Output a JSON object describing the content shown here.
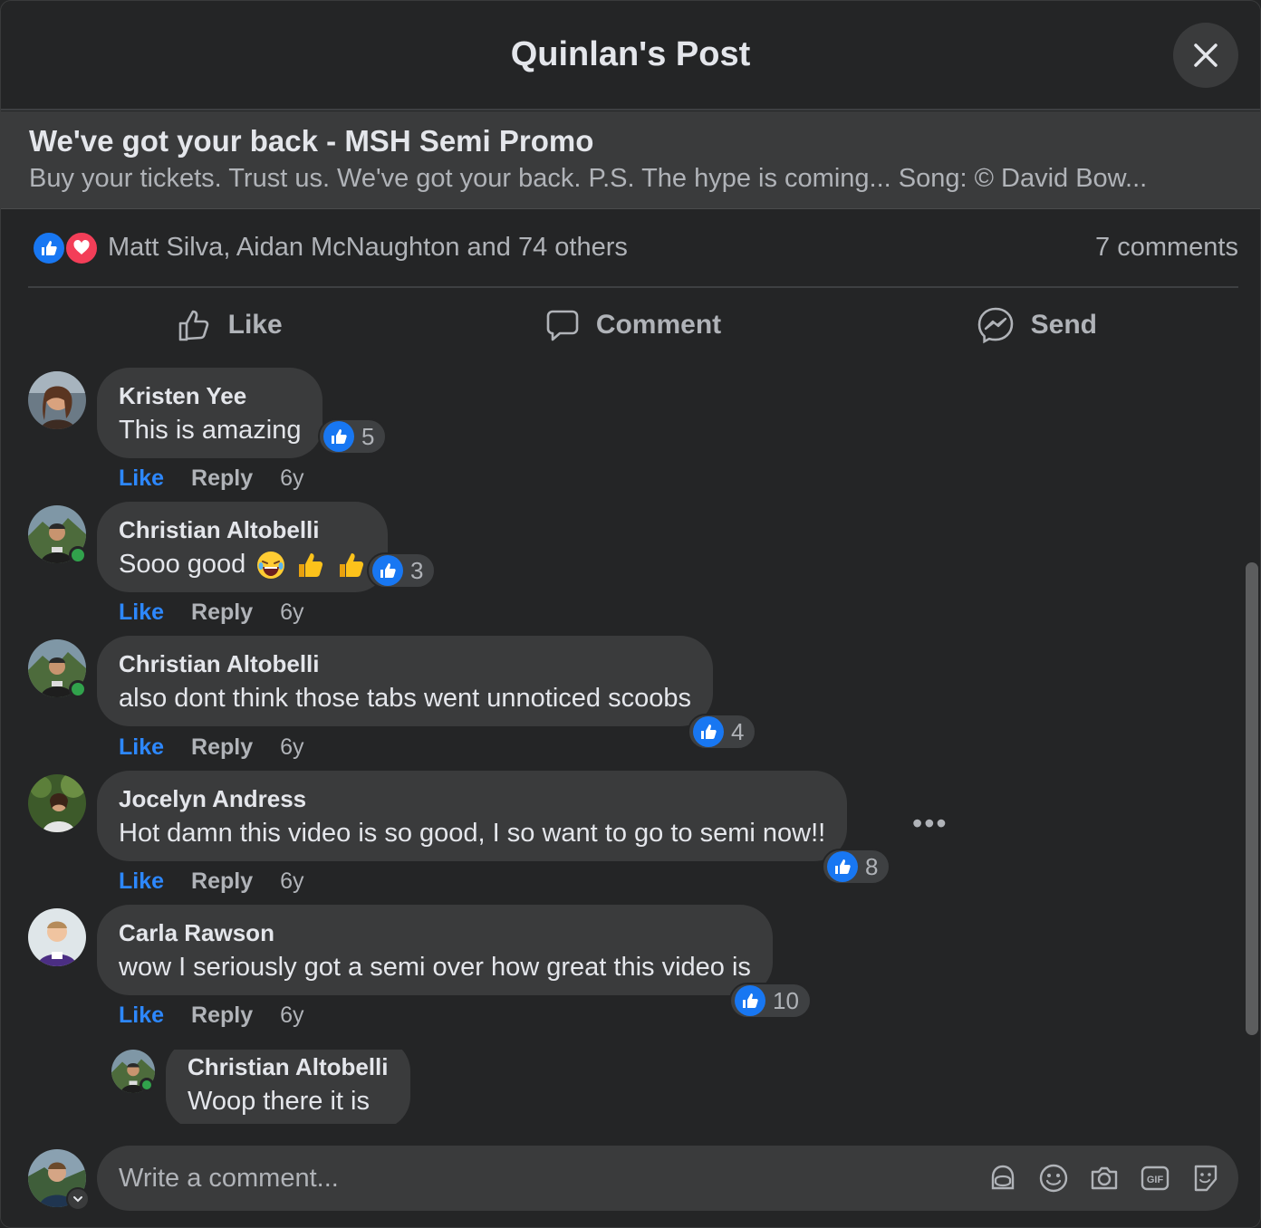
{
  "header": {
    "title": "Quinlan's Post"
  },
  "post": {
    "title": "We've got your back - MSH Semi Promo",
    "description": "Buy your tickets. Trust us. We've got your back. P.S. The hype is coming... Song: © David Bow..."
  },
  "reactions": {
    "names": "Matt Silva, Aidan McNaughton and 74 others",
    "comment_count": "7 comments"
  },
  "actions": {
    "like": "Like",
    "comment": "Comment",
    "send": "Send"
  },
  "comments": [
    {
      "name": "Kristen Yee",
      "text": "This is amazing",
      "likes": "5",
      "like": "Like",
      "reply": "Reply",
      "time": "6y"
    },
    {
      "name": "Christian Altobelli",
      "text": "Sooo good",
      "likes": "3",
      "like": "Like",
      "reply": "Reply",
      "time": "6y"
    },
    {
      "name": "Christian Altobelli",
      "text": "also dont think those tabs went unnoticed scoobs",
      "likes": "4",
      "like": "Like",
      "reply": "Reply",
      "time": "6y"
    },
    {
      "name": "Jocelyn Andress",
      "text": "Hot damn this video is so good, I so want to go to semi now!!",
      "likes": "8",
      "like": "Like",
      "reply": "Reply",
      "time": "6y"
    },
    {
      "name": "Carla Rawson",
      "text": "wow I seriously got a semi over how great this video is",
      "likes": "10",
      "like": "Like",
      "reply": "Reply",
      "time": "6y"
    }
  ],
  "reply": {
    "name": "Christian Altobelli",
    "text": "Woop there it is"
  },
  "composer": {
    "placeholder": "Write a comment..."
  },
  "colors": {
    "background": "#242526",
    "bubble": "#3a3b3c",
    "accent": "#2d88ff",
    "like_blue": "#1877f2",
    "love_red": "#f33e58",
    "online": "#31a24c"
  }
}
